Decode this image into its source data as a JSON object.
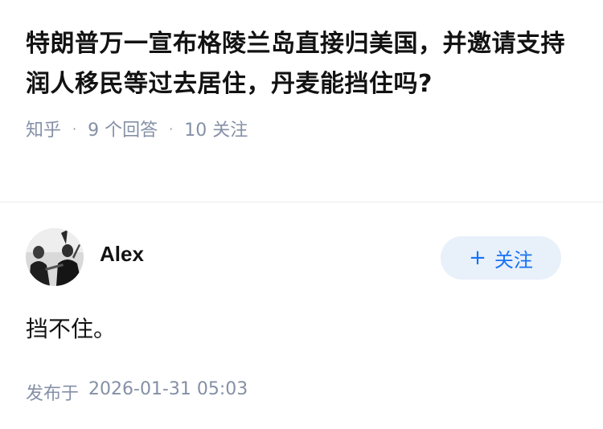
{
  "question": {
    "title": "特朗普万一宣布格陵兰岛直接归美国，并邀请支持润人移民等过去居住，丹麦能挡住吗?",
    "source": "知乎",
    "answers_count": "9 个回答",
    "followers_count": "10 关注",
    "separator": "·"
  },
  "answer": {
    "author_name": "Alex",
    "follow_label": "关注",
    "follow_icon": "plus-icon",
    "content": "挡不住。",
    "published_label": "发布于",
    "published_time": "2026-01-31 05:03"
  },
  "colors": {
    "text_primary": "#121212",
    "text_secondary": "#8590a6",
    "accent": "#1772f6",
    "follow_bg": "#e8f0fa"
  }
}
